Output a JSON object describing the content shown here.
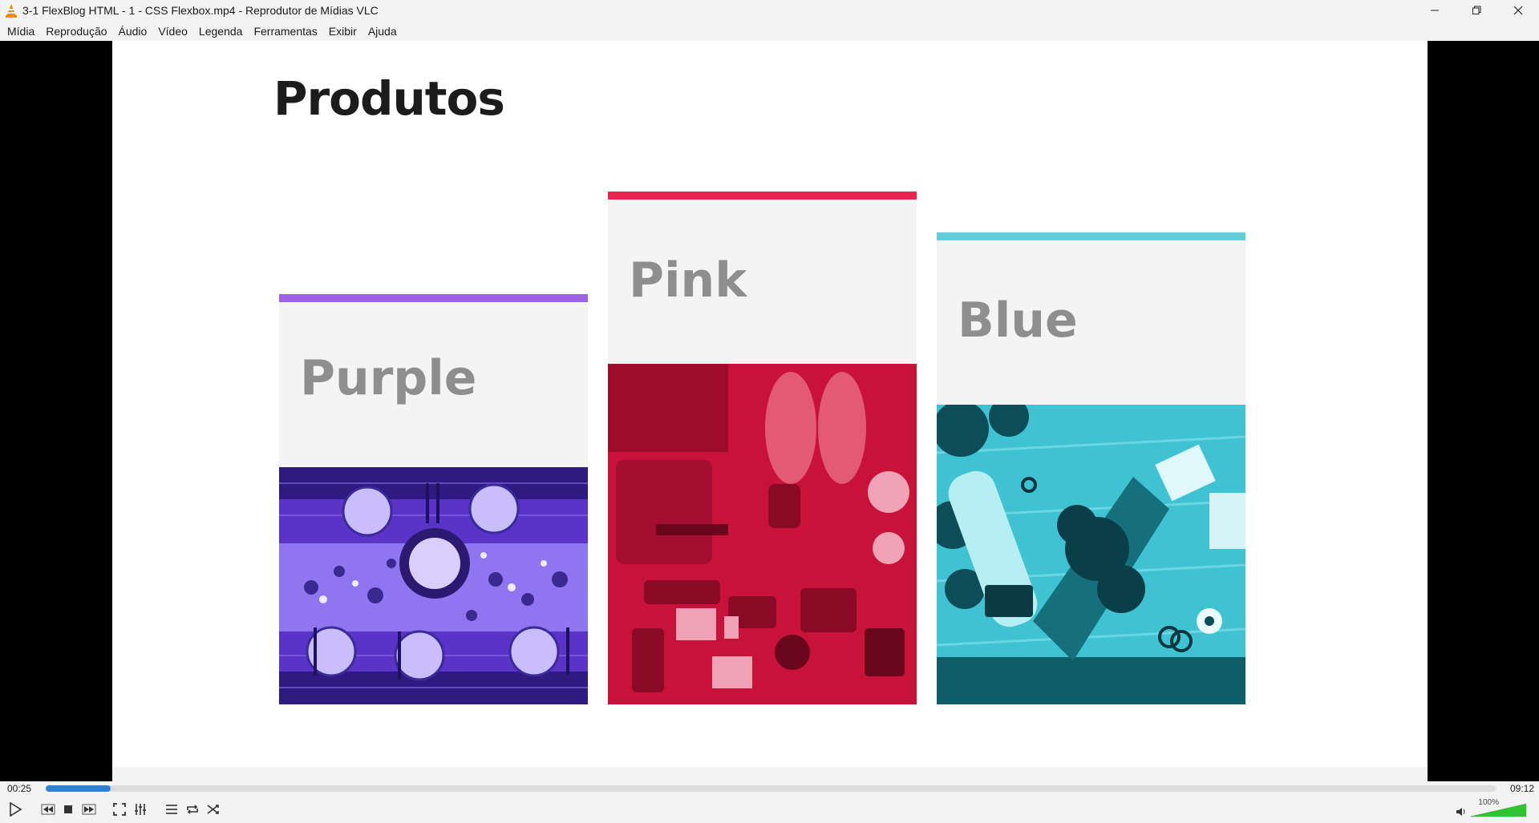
{
  "window": {
    "title": "3-1 FlexBlog HTML - 1 - CSS Flexbox.mp4 - Reprodutor de Mídias VLC",
    "app_icon": "vlc-cone-icon",
    "minimize_icon": "minimize-icon",
    "maximize_icon": "restore-icon",
    "close_icon": "close-icon"
  },
  "menu": {
    "items": [
      "Mídia",
      "Reprodução",
      "Áudio",
      "Vídeo",
      "Legenda",
      "Ferramentas",
      "Exibir",
      "Ajuda"
    ]
  },
  "video_frame": {
    "heading": "Produtos",
    "cards": [
      {
        "label": "Purple",
        "accent": "#9c63e6",
        "tint": "#6a3fd6"
      },
      {
        "label": "Pink",
        "accent": "#e8254f",
        "tint": "#d8143f"
      },
      {
        "label": "Blue",
        "accent": "#5fcfdc",
        "tint": "#2fb8c8"
      }
    ]
  },
  "playback": {
    "current_time": "00:25",
    "total_time": "09:12",
    "progress": 0.045,
    "volume_label": "100%",
    "volume": 1.0,
    "accent_color": "#2d82d4",
    "volume_color": "#2ec42e",
    "buttons": [
      "play-icon",
      "previous-icon",
      "stop-icon",
      "next-icon",
      "fullscreen-icon",
      "extended-settings-icon",
      "playlist-icon",
      "loop-icon",
      "shuffle-icon"
    ]
  }
}
